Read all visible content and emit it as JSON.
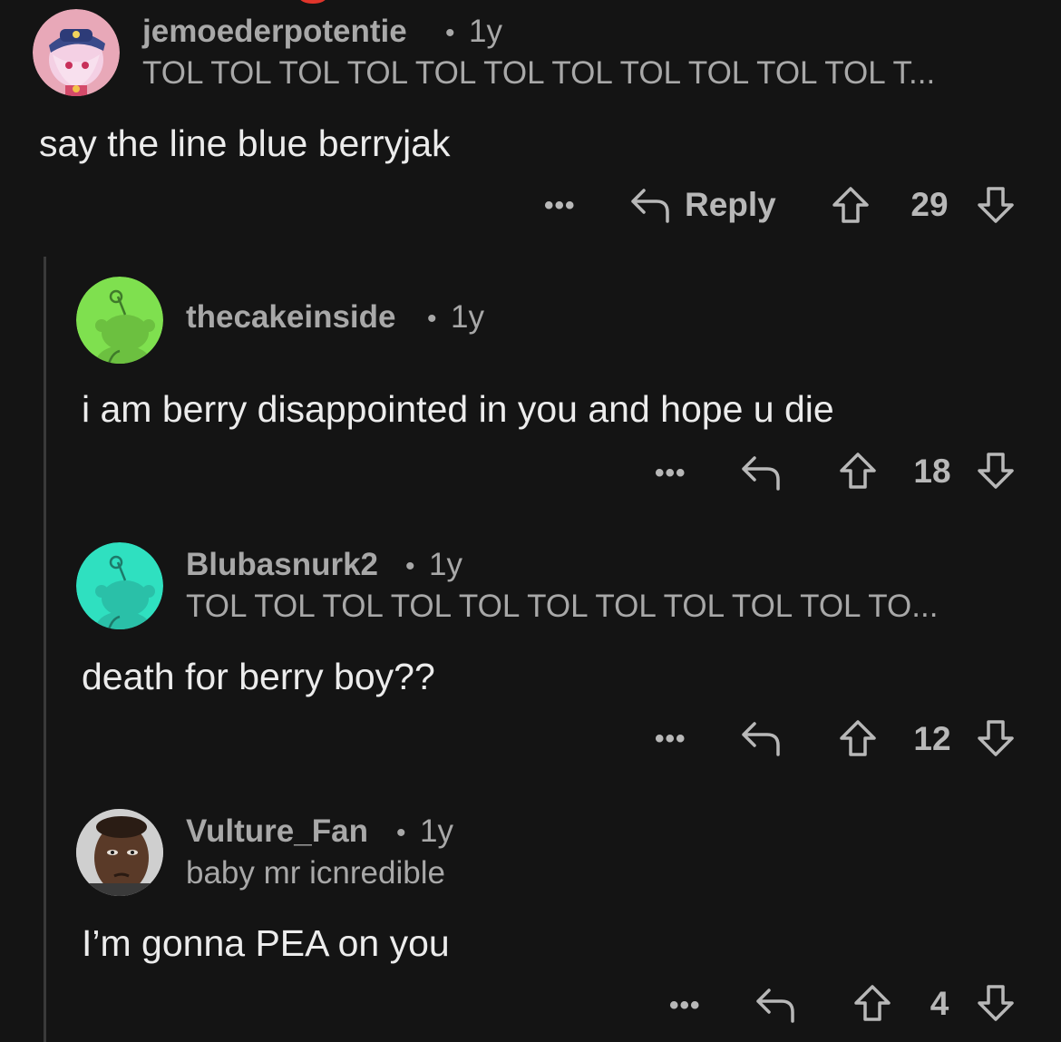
{
  "comments": [
    {
      "username": "jemoederpotentie",
      "separator": "•",
      "age": "1y",
      "flair": "TOL TOL TOL TOL TOL TOL TOL TOL TOL TOL TOL T...",
      "body": "say the line blue berryjak",
      "actions": {
        "more": "•••",
        "reply": "Reply",
        "votes": "29"
      },
      "avatar_colors": {
        "bg": "#e8a8b8",
        "hair": "#f0c8e0",
        "hat": "#3a4a8a"
      }
    },
    {
      "username": "thecakeinside",
      "separator": "•",
      "age": "1y",
      "flair": "",
      "body": "i am berry disappointed in you and hope u die",
      "actions": {
        "more": "•••",
        "votes": "18"
      },
      "avatar_colors": {
        "bg": "#7fe04f",
        "snoo": "#6cc040"
      }
    },
    {
      "username": "Blubasnurk2",
      "separator": "•",
      "age": "1y",
      "flair": "TOL TOL TOL TOL TOL TOL TOL TOL TOL TOL TO...",
      "body": "death for berry boy??",
      "actions": {
        "more": "•••",
        "votes": "12"
      },
      "avatar_colors": {
        "bg": "#2fe0c0",
        "snoo": "#2ac0a8"
      }
    },
    {
      "username": "Vulture_Fan",
      "separator": "•",
      "age": "1y",
      "flair": "baby mr icnredible",
      "body": "I’m gonna PEA on you",
      "actions": {
        "more": "•••",
        "votes": "4"
      },
      "avatar_colors": {
        "bg": "#d8d8d8",
        "face": "#5a3a28"
      }
    }
  ],
  "icons": {
    "reply": "reply-arrow-icon",
    "upvote": "upvote-arrow-icon",
    "downvote": "downvote-arrow-icon",
    "more": "more-options-icon"
  },
  "theme": {
    "background": "#141414",
    "text_primary": "#ececec",
    "text_secondary": "#a8a8a8",
    "thread_line": "#3a3a3a"
  }
}
